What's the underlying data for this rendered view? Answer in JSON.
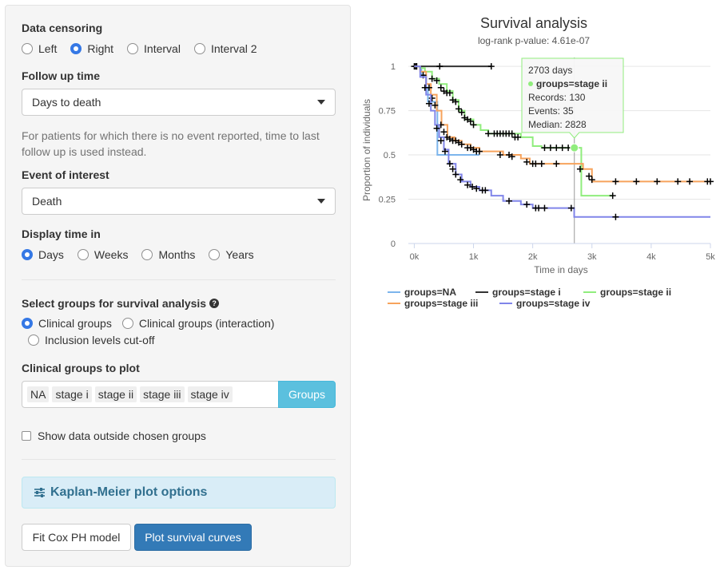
{
  "panel": {
    "censoring": {
      "label": "Data censoring",
      "options": [
        "Left",
        "Right",
        "Interval",
        "Interval 2"
      ],
      "selected": "Right"
    },
    "follow_up": {
      "label": "Follow up time",
      "value": "Days to death",
      "help": "For patients for which there is no event reported, time to last follow up is used instead."
    },
    "event": {
      "label": "Event of interest",
      "value": "Death"
    },
    "display_time": {
      "label": "Display time in",
      "options": [
        "Days",
        "Weeks",
        "Months",
        "Years"
      ],
      "selected": "Days"
    },
    "groups_select": {
      "label": "Select groups for survival analysis",
      "options": [
        "Clinical groups",
        "Clinical groups (interaction)",
        "Inclusion levels cut-off"
      ],
      "selected": "Clinical groups"
    },
    "clinical_groups": {
      "label": "Clinical groups to plot",
      "tags": [
        "NA",
        "stage i",
        "stage ii",
        "stage iii",
        "stage iv"
      ],
      "button": "Groups"
    },
    "outside_checkbox": {
      "label": "Show data outside chosen groups",
      "checked": false
    },
    "km_options": {
      "label": "Kaplan-Meier plot options",
      "icon": "sliders-icon"
    },
    "buttons": {
      "fit_cox": "Fit Cox PH model",
      "plot_curves": "Plot survival curves"
    }
  },
  "chart_data": {
    "type": "line",
    "step": true,
    "title": "Survival analysis",
    "subtitle": "log-rank p-value: 4.61e-07",
    "xlabel": "Time in days",
    "ylabel": "Proportion of individuals",
    "xlim": [
      -100,
      5000
    ],
    "ylim": [
      0,
      1.05
    ],
    "xticks": [
      0,
      1000,
      2000,
      3000,
      4000,
      5000
    ],
    "xtick_labels": [
      "0k",
      "1k",
      "2k",
      "3k",
      "4k",
      "5k"
    ],
    "yticks": [
      0,
      0.25,
      0.5,
      0.75,
      1
    ],
    "ytick_labels": [
      "0",
      "0.25",
      "0.5",
      "0.75",
      "1"
    ],
    "grid": true,
    "legend_position": "bottom",
    "series": [
      {
        "name": "groups=NA",
        "color": "#7cb5ec",
        "points": [
          [
            0,
            1
          ],
          [
            50,
            1
          ],
          [
            120,
            0.95
          ],
          [
            200,
            0.88
          ],
          [
            230,
            0.8
          ],
          [
            380,
            0.8
          ],
          [
            390,
            0.5
          ],
          [
            1100,
            0.5
          ]
        ],
        "censored": [
          [
            40,
            1
          ]
        ]
      },
      {
        "name": "groups=stage i",
        "color": "#333333",
        "points": [
          [
            0,
            1
          ],
          [
            1300,
            1
          ]
        ],
        "censored": [
          [
            0,
            1
          ],
          [
            20,
            1
          ],
          [
            40,
            1
          ],
          [
            430,
            1
          ],
          [
            1300,
            1
          ]
        ]
      },
      {
        "name": "groups=stage ii",
        "color": "#90ed7d",
        "points": [
          [
            0,
            1
          ],
          [
            100,
            0.99
          ],
          [
            180,
            0.97
          ],
          [
            300,
            0.93
          ],
          [
            420,
            0.9
          ],
          [
            550,
            0.86
          ],
          [
            650,
            0.81
          ],
          [
            750,
            0.75
          ],
          [
            850,
            0.7
          ],
          [
            1000,
            0.67
          ],
          [
            1120,
            0.64
          ],
          [
            1250,
            0.62
          ],
          [
            1600,
            0.62
          ],
          [
            1800,
            0.6
          ],
          [
            2000,
            0.55
          ],
          [
            2150,
            0.54
          ],
          [
            2700,
            0.54
          ],
          [
            2820,
            0.27
          ],
          [
            3350,
            0.27
          ]
        ],
        "censored": [
          [
            300,
            0.93
          ],
          [
            380,
            0.92
          ],
          [
            450,
            0.88
          ],
          [
            500,
            0.86
          ],
          [
            550,
            0.85
          ],
          [
            600,
            0.85
          ],
          [
            650,
            0.81
          ],
          [
            700,
            0.8
          ],
          [
            750,
            0.76
          ],
          [
            800,
            0.74
          ],
          [
            850,
            0.71
          ],
          [
            900,
            0.7
          ],
          [
            950,
            0.69
          ],
          [
            1000,
            0.67
          ],
          [
            1250,
            0.62
          ],
          [
            1350,
            0.62
          ],
          [
            1400,
            0.62
          ],
          [
            1450,
            0.62
          ],
          [
            1500,
            0.62
          ],
          [
            1550,
            0.62
          ],
          [
            1600,
            0.62
          ],
          [
            1650,
            0.62
          ],
          [
            1700,
            0.6
          ],
          [
            1750,
            0.6
          ],
          [
            2200,
            0.54
          ],
          [
            2300,
            0.54
          ],
          [
            2400,
            0.54
          ],
          [
            2500,
            0.54
          ],
          [
            2600,
            0.54
          ],
          [
            2680,
            0.54
          ],
          [
            2700,
            0.54
          ],
          [
            3350,
            0.27
          ]
        ]
      },
      {
        "name": "groups=stage iii",
        "color": "#f7a35c",
        "points": [
          [
            0,
            1
          ],
          [
            100,
            0.97
          ],
          [
            200,
            0.9
          ],
          [
            280,
            0.84
          ],
          [
            380,
            0.75
          ],
          [
            460,
            0.67
          ],
          [
            560,
            0.6
          ],
          [
            680,
            0.58
          ],
          [
            800,
            0.56
          ],
          [
            950,
            0.54
          ],
          [
            1100,
            0.52
          ],
          [
            1500,
            0.5
          ],
          [
            1800,
            0.48
          ],
          [
            1950,
            0.45
          ],
          [
            2700,
            0.45
          ],
          [
            2850,
            0.42
          ],
          [
            3000,
            0.35
          ],
          [
            5000,
            0.35
          ]
        ],
        "censored": [
          [
            150,
            0.95
          ],
          [
            250,
            0.88
          ],
          [
            300,
            0.82
          ],
          [
            350,
            0.78
          ],
          [
            450,
            0.67
          ],
          [
            500,
            0.63
          ],
          [
            550,
            0.6
          ],
          [
            600,
            0.59
          ],
          [
            650,
            0.58
          ],
          [
            700,
            0.58
          ],
          [
            750,
            0.57
          ],
          [
            800,
            0.56
          ],
          [
            900,
            0.54
          ],
          [
            950,
            0.54
          ],
          [
            1000,
            0.53
          ],
          [
            1050,
            0.52
          ],
          [
            1100,
            0.52
          ],
          [
            1450,
            0.5
          ],
          [
            1600,
            0.5
          ],
          [
            1650,
            0.49
          ],
          [
            1900,
            0.46
          ],
          [
            2000,
            0.45
          ],
          [
            2050,
            0.45
          ],
          [
            2150,
            0.45
          ],
          [
            2400,
            0.45
          ],
          [
            2800,
            0.42
          ],
          [
            2950,
            0.38
          ],
          [
            3000,
            0.36
          ],
          [
            3400,
            0.35
          ],
          [
            3750,
            0.35
          ],
          [
            4100,
            0.35
          ],
          [
            4450,
            0.35
          ],
          [
            4650,
            0.35
          ],
          [
            4950,
            0.35
          ],
          [
            5000,
            0.35
          ]
        ]
      },
      {
        "name": "groups=stage iv",
        "color": "#8085e9",
        "points": [
          [
            0,
            1
          ],
          [
            100,
            0.94
          ],
          [
            200,
            0.84
          ],
          [
            280,
            0.75
          ],
          [
            350,
            0.67
          ],
          [
            420,
            0.6
          ],
          [
            500,
            0.53
          ],
          [
            580,
            0.45
          ],
          [
            700,
            0.39
          ],
          [
            800,
            0.35
          ],
          [
            950,
            0.32
          ],
          [
            1100,
            0.3
          ],
          [
            1300,
            0.27
          ],
          [
            1500,
            0.24
          ],
          [
            1800,
            0.22
          ],
          [
            2000,
            0.2
          ],
          [
            2600,
            0.2
          ],
          [
            2700,
            0.15
          ],
          [
            5000,
            0.15
          ]
        ],
        "censored": [
          [
            180,
            0.88
          ],
          [
            250,
            0.79
          ],
          [
            380,
            0.65
          ],
          [
            450,
            0.58
          ],
          [
            520,
            0.52
          ],
          [
            600,
            0.45
          ],
          [
            650,
            0.42
          ],
          [
            700,
            0.39
          ],
          [
            780,
            0.36
          ],
          [
            900,
            0.33
          ],
          [
            980,
            0.32
          ],
          [
            1050,
            0.31
          ],
          [
            1150,
            0.3
          ],
          [
            1200,
            0.3
          ],
          [
            1600,
            0.24
          ],
          [
            1900,
            0.22
          ],
          [
            2050,
            0.2
          ],
          [
            2100,
            0.2
          ],
          [
            2200,
            0.2
          ],
          [
            2650,
            0.2
          ],
          [
            3400,
            0.15
          ]
        ]
      }
    ],
    "tooltip": {
      "x": 2703,
      "y": 0.54,
      "lines": [
        "2703 days",
        "groups=stage ii",
        "Records: 130",
        "Events: 35",
        "Median: 2828"
      ]
    }
  }
}
